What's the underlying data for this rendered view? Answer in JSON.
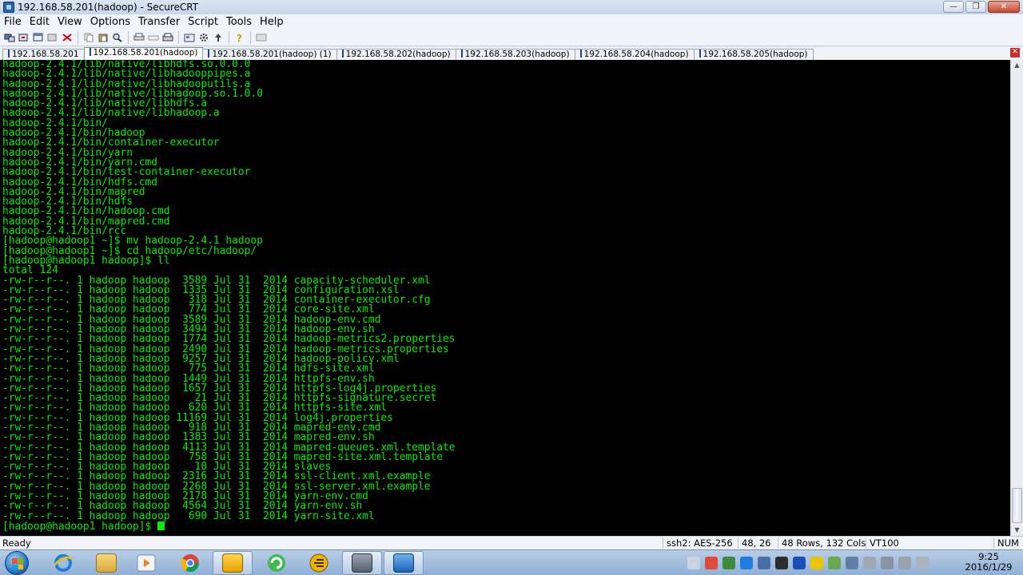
{
  "window": {
    "title": "192.168.58.201(hadoop) - SecureCRT",
    "buttons": {
      "minimize": "—",
      "maximize": "❐",
      "close": "✕"
    }
  },
  "menu": [
    "File",
    "Edit",
    "View",
    "Options",
    "Transfer",
    "Script",
    "Tools",
    "Help"
  ],
  "tabs": [
    {
      "label": "192.168.58.201",
      "active": false
    },
    {
      "label": "192.168.58.201(hadoop)",
      "active": true
    },
    {
      "label": "192.168.58.201(hadoop) (1)",
      "active": false
    },
    {
      "label": "192.168.58.202(hadoop)",
      "active": false
    },
    {
      "label": "192.168.58.203(hadoop)",
      "active": false
    },
    {
      "label": "192.168.58.204(hadoop)",
      "active": false
    },
    {
      "label": "192.168.58.205(hadoop)",
      "active": false
    }
  ],
  "terminal": {
    "lines": [
      "hadoop-2.4.1/lib/native/libhdfs.so.0.0.0",
      "hadoop-2.4.1/lib/native/libhadooppipes.a",
      "hadoop-2.4.1/lib/native/libhadooputils.a",
      "hadoop-2.4.1/lib/native/libhadoop.so.1.0.0",
      "hadoop-2.4.1/lib/native/libhdfs.a",
      "hadoop-2.4.1/lib/native/libhadoop.a",
      "hadoop-2.4.1/bin/",
      "hadoop-2.4.1/bin/hadoop",
      "hadoop-2.4.1/bin/container-executor",
      "hadoop-2.4.1/bin/yarn",
      "hadoop-2.4.1/bin/yarn.cmd",
      "hadoop-2.4.1/bin/test-container-executor",
      "hadoop-2.4.1/bin/hdfs.cmd",
      "hadoop-2.4.1/bin/mapred",
      "hadoop-2.4.1/bin/hdfs",
      "hadoop-2.4.1/bin/hadoop.cmd",
      "hadoop-2.4.1/bin/mapred.cmd",
      "hadoop-2.4.1/bin/rcc",
      "[hadoop@hadoop1 ~]$ mv hadoop-2.4.1 hadoop",
      "[hadoop@hadoop1 ~]$ cd hadoop/etc/hadoop/",
      "[hadoop@hadoop1 hadoop]$ ll",
      "total 124",
      "-rw-r--r--. 1 hadoop hadoop  3589 Jul 31  2014 capacity-scheduler.xml",
      "-rw-r--r--. 1 hadoop hadoop  1335 Jul 31  2014 configuration.xsl",
      "-rw-r--r--. 1 hadoop hadoop   318 Jul 31  2014 container-executor.cfg",
      "-rw-r--r--. 1 hadoop hadoop   774 Jul 31  2014 core-site.xml",
      "-rw-r--r--. 1 hadoop hadoop  3589 Jul 31  2014 hadoop-env.cmd",
      "-rw-r--r--. 1 hadoop hadoop  3494 Jul 31  2014 hadoop-env.sh",
      "-rw-r--r--. 1 hadoop hadoop  1774 Jul 31  2014 hadoop-metrics2.properties",
      "-rw-r--r--. 1 hadoop hadoop  2490 Jul 31  2014 hadoop-metrics.properties",
      "-rw-r--r--. 1 hadoop hadoop  9257 Jul 31  2014 hadoop-policy.xml",
      "-rw-r--r--. 1 hadoop hadoop   775 Jul 31  2014 hdfs-site.xml",
      "-rw-r--r--. 1 hadoop hadoop  1449 Jul 31  2014 httpfs-env.sh",
      "-rw-r--r--. 1 hadoop hadoop  1657 Jul 31  2014 httpfs-log4j.properties",
      "-rw-r--r--. 1 hadoop hadoop    21 Jul 31  2014 httpfs-signature.secret",
      "-rw-r--r--. 1 hadoop hadoop   620 Jul 31  2014 httpfs-site.xml",
      "-rw-r--r--. 1 hadoop hadoop 11169 Jul 31  2014 log4j.properties",
      "-rw-r--r--. 1 hadoop hadoop   918 Jul 31  2014 mapred-env.cmd",
      "-rw-r--r--. 1 hadoop hadoop  1383 Jul 31  2014 mapred-env.sh",
      "-rw-r--r--. 1 hadoop hadoop  4113 Jul 31  2014 mapred-queues.xml.template",
      "-rw-r--r--. 1 hadoop hadoop   758 Jul 31  2014 mapred-site.xml.template",
      "-rw-r--r--. 1 hadoop hadoop    10 Jul 31  2014 slaves",
      "-rw-r--r--. 1 hadoop hadoop  2316 Jul 31  2014 ssl-client.xml.example",
      "-rw-r--r--. 1 hadoop hadoop  2268 Jul 31  2014 ssl-server.xml.example",
      "-rw-r--r--. 1 hadoop hadoop  2178 Jul 31  2014 yarn-env.cmd",
      "-rw-r--r--. 1 hadoop hadoop  4564 Jul 31  2014 yarn-env.sh",
      "-rw-r--r--. 1 hadoop hadoop   690 Jul 31  2014 yarn-site.xml"
    ],
    "prompt": "[hadoop@hadoop1 hadoop]$ ",
    "text_color": "#00ee00",
    "background": "#000000"
  },
  "statusbar": {
    "ready": "Ready",
    "protocol": "ssh2: AES-256",
    "cursor_pos": "48,  26",
    "size": "48 Rows, 132 Cols",
    "emulation": "VT100",
    "num": "NUM"
  },
  "taskbar": {
    "apps": [
      "start-button",
      "internet-explorer-icon",
      "file-explorer-icon",
      "media-player-icon",
      "chrome-icon",
      "app-manager-icon",
      "refresh-app-icon",
      "editor-app-icon",
      "terminal-app-icon",
      "securecrt-icon"
    ],
    "clock_time": "9:25",
    "clock_date": "2016/1/29"
  }
}
